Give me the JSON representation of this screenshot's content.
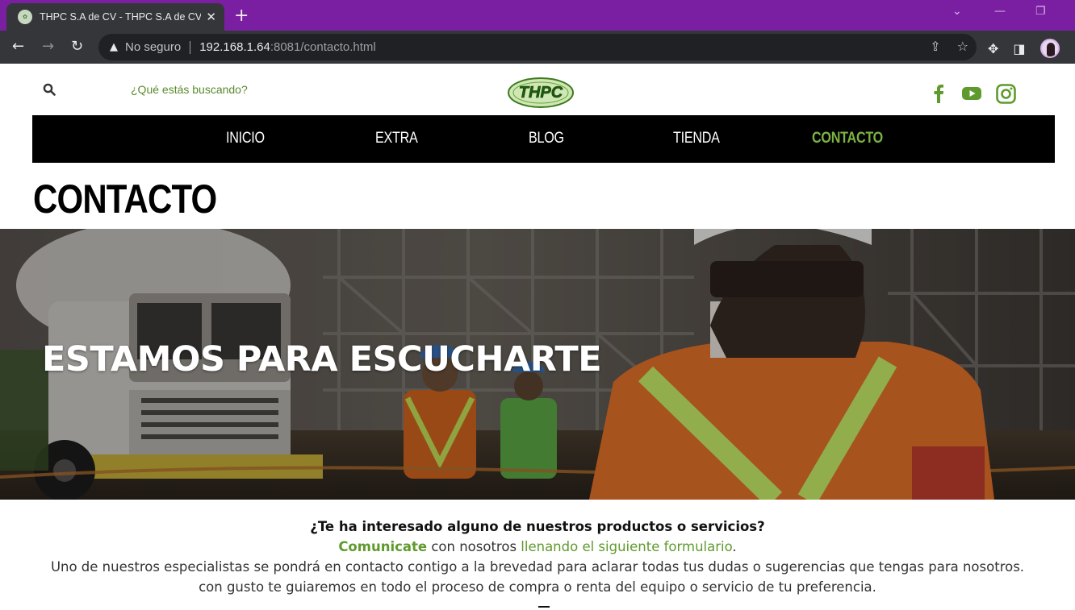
{
  "browser": {
    "tab_title": "THPC S.A de CV - THPC S.A de CV",
    "tab_close": "✕",
    "new_tab": "+",
    "security_label": "No seguro",
    "url_host": "192.168.1.64",
    "url_path": ":8081/contacto.html"
  },
  "header": {
    "search_placeholder": "¿Qué estás buscando?",
    "logo_text": "THPC"
  },
  "nav": {
    "items": [
      "INICIO",
      "EXTRA",
      "BLOG",
      "TIENDA",
      "CONTACTO"
    ],
    "active": "CONTACTO"
  },
  "page": {
    "title": "CONTACTO"
  },
  "hero": {
    "headline": "ESTAMOS PARA ESCUCHARTE"
  },
  "intro": {
    "question": "¿Te ha interesado alguno de nuestros productos o servicios?",
    "cta_bold": "Comunicate",
    "cta_mid": " con nosotros ",
    "cta_link": "llenando el siguiente formulario",
    "cta_end": ".",
    "body": "Uno de nuestros especialistas se pondrá en contacto contigo a la brevedad para aclarar todas tus dudas o sugerencias que tengas para nosotros. con gusto te guiaremos en todo el proceso de compra o renta del equipo o servicio de tu preferencia."
  },
  "colors": {
    "brand_green": "#5f9a2d",
    "nav_active": "#7cb342",
    "tabbar_purple": "#7b1fa2",
    "nav_bg": "#000000"
  },
  "icons": {
    "search": "search-icon",
    "facebook": "facebook-icon",
    "youtube": "youtube-icon",
    "instagram": "instagram-icon"
  }
}
